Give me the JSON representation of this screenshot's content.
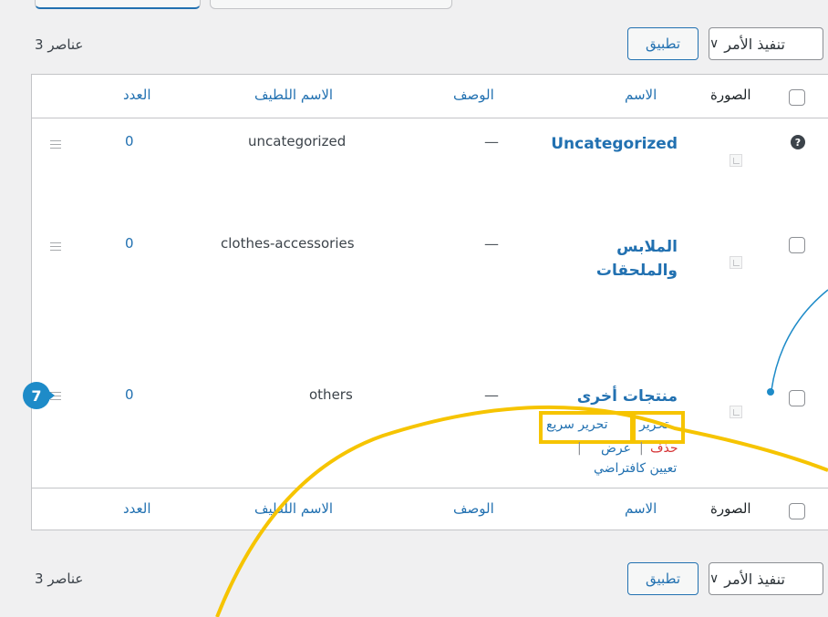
{
  "bulk_top": {
    "label": "تنفيذ الأمر",
    "chevron": "chevron-down-icon",
    "apply": "تطبيق",
    "count": "3 عناصر"
  },
  "bulk_bottom": {
    "label": "تنفيذ الأمر",
    "chevron": "chevron-down-icon",
    "apply": "تطبيق",
    "count": "3 عناصر"
  },
  "columns": {
    "image": "الصورة",
    "name": "الاسم",
    "description": "الوصف",
    "slug": "الاسم اللطيف",
    "count": "العدد"
  },
  "rows": [
    {
      "name": "Uncategorized",
      "description": "—",
      "slug": "uncategorized",
      "count": "0"
    },
    {
      "name_line1": "الملابس",
      "name_line2": "والملحقات",
      "description": "—",
      "slug": "clothes-accessories",
      "count": "0"
    },
    {
      "name": "منتجات أخرى",
      "description": "—",
      "slug": "others",
      "count": "0"
    }
  ],
  "row_actions": {
    "edit": "تحرير",
    "quick_edit": "تحرير سريع",
    "delete": "حذف",
    "view": "عرض",
    "make_default": "تعيين كافتراضي",
    "separator": "|"
  },
  "help_icon_glyph": "?",
  "callout": {
    "number": "7",
    "color": "#1e8bc8"
  },
  "colors": {
    "link": "#2271b1",
    "delete": "#d63638",
    "highlight": "#f6c400"
  }
}
